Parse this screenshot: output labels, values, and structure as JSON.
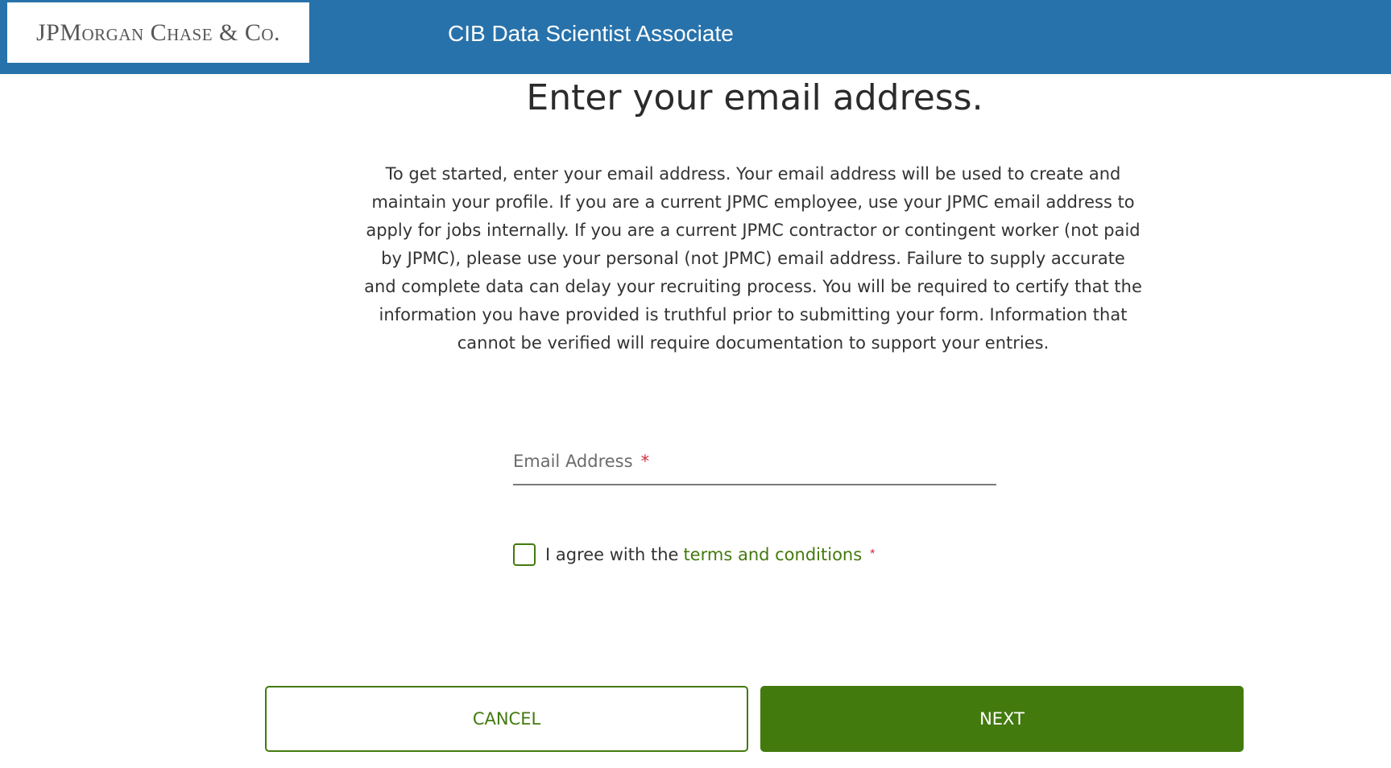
{
  "header": {
    "logo_text": "JPMorgan Chase & Co.",
    "job_title": "CIB Data Scientist Associate",
    "background_color": "#2872ab"
  },
  "main": {
    "heading": "Enter your email address.",
    "intro_text": "To get started, enter your email address. Your email address will be used to create and maintain your profile. If you are a current JPMC employee, use your JPMC email address to apply for jobs internally. If you are a current JPMC contractor or contingent worker (not paid by JPMC), please use your personal (not JPMC) email address. Failure to supply accurate and complete data can delay your recruiting process. You will be required to certify that the information you have provided is truthful prior to submitting your form. Information that cannot be verified will require documentation to support your entries."
  },
  "form": {
    "email_label": "Email Address",
    "email_value": "",
    "required_marker": "*",
    "agree_text": "I agree with the",
    "terms_link": "terms and conditions",
    "checkbox_checked": false
  },
  "actions": {
    "cancel_label": "CANCEL",
    "next_label": "NEXT",
    "accent_color": "#437a0e"
  }
}
